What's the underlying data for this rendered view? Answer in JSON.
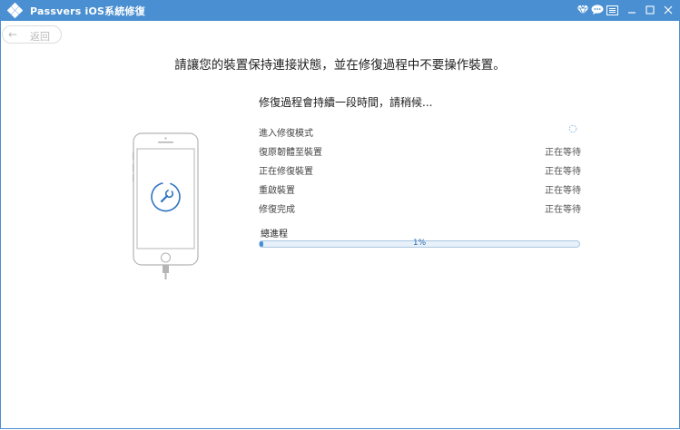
{
  "window": {
    "title": "Passvers iOS系統修復",
    "accent_color": "#4a8fd1",
    "toolbar_icons": [
      "diamond-icon",
      "chat-icon",
      "menu-icon",
      "minimize-icon",
      "maximize-icon",
      "close-icon"
    ]
  },
  "back_button": {
    "label": "返回"
  },
  "headline": "請讓您的裝置保持連接狀態，並在修復過程中不要操作裝置。",
  "subhead": "修復過程會持續一段時間，請稍候...",
  "steps": [
    {
      "label": "進入修復模式",
      "status": "",
      "state": "in-progress"
    },
    {
      "label": "復原韌體至裝置",
      "status": "正在等待",
      "state": "waiting"
    },
    {
      "label": "正在修復裝置",
      "status": "正在等待",
      "state": "waiting"
    },
    {
      "label": "重啟裝置",
      "status": "正在等待",
      "state": "waiting"
    },
    {
      "label": "修復完成",
      "status": "正在等待",
      "state": "waiting"
    }
  ],
  "progress": {
    "label": "總進程",
    "percent_text": "1%",
    "value": 0.01
  }
}
